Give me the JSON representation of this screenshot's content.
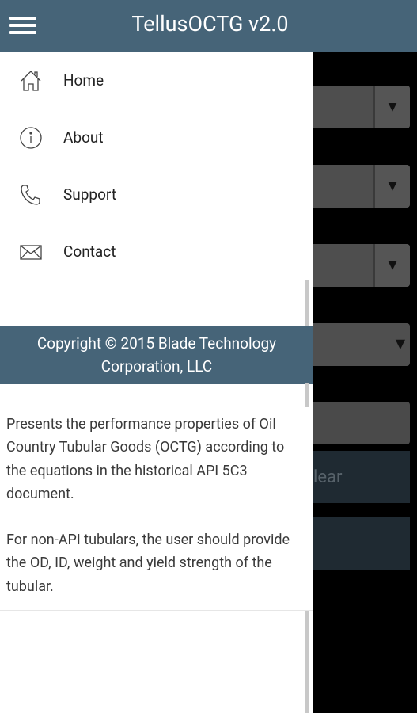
{
  "header": {
    "title": "TellusOCTG v2.0"
  },
  "nav": {
    "items": [
      {
        "label": "Home",
        "icon": "home-icon"
      },
      {
        "label": "About",
        "icon": "info-icon"
      },
      {
        "label": "Support",
        "icon": "phone-icon"
      },
      {
        "label": "Contact",
        "icon": "mail-icon"
      }
    ]
  },
  "copyright": {
    "line1": "Copyright © 2015 Blade Technology",
    "line2": "Corporation, LLC"
  },
  "description": {
    "para1": "Presents the performance properties of Oil Country Tubular Goods (OCTG) according to the equations in the historical API 5C3 document.",
    "para2": "For non-API tubulars, the user should provide the OD, ID, weight and yield strength of the tubular."
  },
  "background_app": {
    "clear_label": "lear"
  },
  "colors": {
    "primary": "#466478",
    "drawer_bg": "#ffffff",
    "text": "#222222"
  }
}
